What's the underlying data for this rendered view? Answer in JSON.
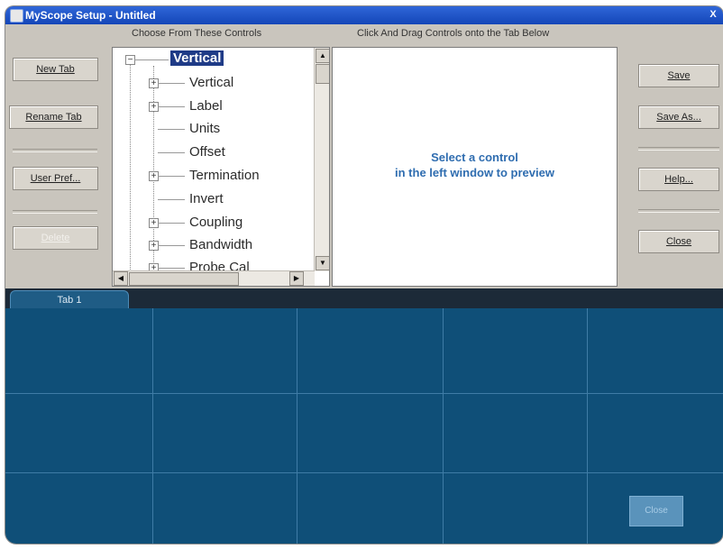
{
  "window": {
    "title": "MyScope Setup - Untitled",
    "close_label": "X"
  },
  "captions": {
    "controls": "Choose From These Controls",
    "preview": "Click And Drag Controls onto the Tab Below"
  },
  "left_buttons": {
    "new_tab": "New Tab",
    "rename_tab": "Rename Tab",
    "user_pref": "User Pref...",
    "delete": "Delete"
  },
  "right_buttons": {
    "save": "Save",
    "save_as": "Save As...",
    "help": "Help...",
    "close": "Close"
  },
  "tree": {
    "root": "Vertical",
    "items": [
      {
        "label": "Vertical",
        "expandable": true
      },
      {
        "label": "Label",
        "expandable": true
      },
      {
        "label": "Units",
        "expandable": false
      },
      {
        "label": "Offset",
        "expandable": false
      },
      {
        "label": "Termination",
        "expandable": true
      },
      {
        "label": "Invert",
        "expandable": false
      },
      {
        "label": "Coupling",
        "expandable": true
      },
      {
        "label": "Bandwidth",
        "expandable": true
      },
      {
        "label": "Probe Cal",
        "expandable": true
      }
    ]
  },
  "preview": {
    "line1": "Select a control",
    "line2": "in the left window to preview"
  },
  "tabs": [
    {
      "label": "Tab 1"
    }
  ],
  "grid_button": "Close",
  "colors": {
    "titlebar": "#1446b8",
    "window_bg": "#c9c5bd",
    "tab_area": "#0f4f78",
    "accent_text": "#2f6db0"
  }
}
